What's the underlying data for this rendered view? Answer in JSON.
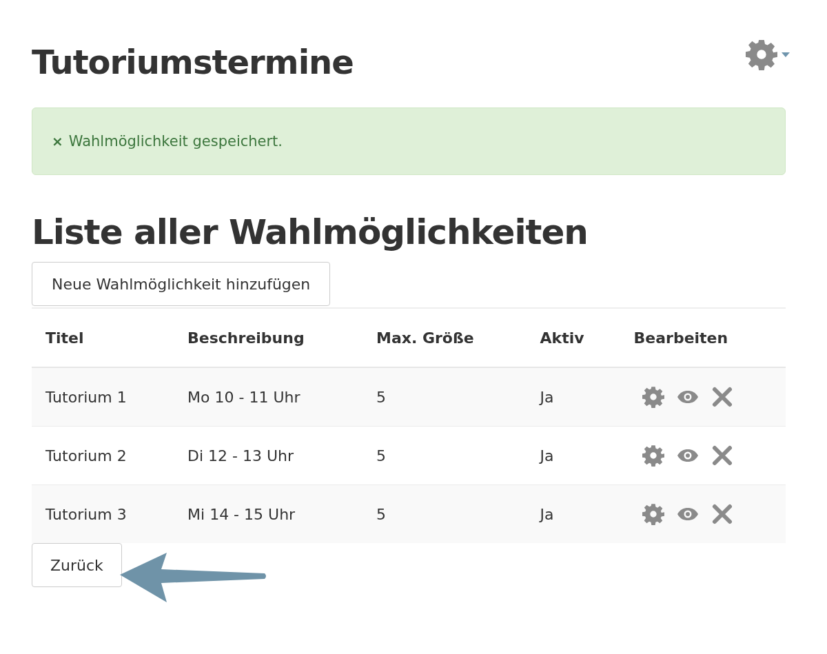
{
  "page_title": "Tutoriumstermine",
  "alert": {
    "close": "×",
    "message": "Wahlmöglichkeit gespeichert."
  },
  "section_title": "Liste aller Wahlmöglichkeiten",
  "add_button": "Neue Wahlmöglichkeit hinzufügen",
  "table": {
    "columns": [
      "Titel",
      "Beschreibung",
      "Max. Größe",
      "Aktiv",
      "Bearbeiten"
    ],
    "rows": [
      {
        "cells": [
          "Tutorium 1",
          "Mo 10 - 11 Uhr",
          "5",
          "Ja"
        ]
      },
      {
        "cells": [
          "Tutorium 2",
          "Di 12 - 13 Uhr",
          "5",
          "Ja"
        ]
      },
      {
        "cells": [
          "Tutorium 3",
          "Mi 14 - 15 Uhr",
          "5",
          "Ja"
        ]
      }
    ]
  },
  "back_button": "Zurück"
}
